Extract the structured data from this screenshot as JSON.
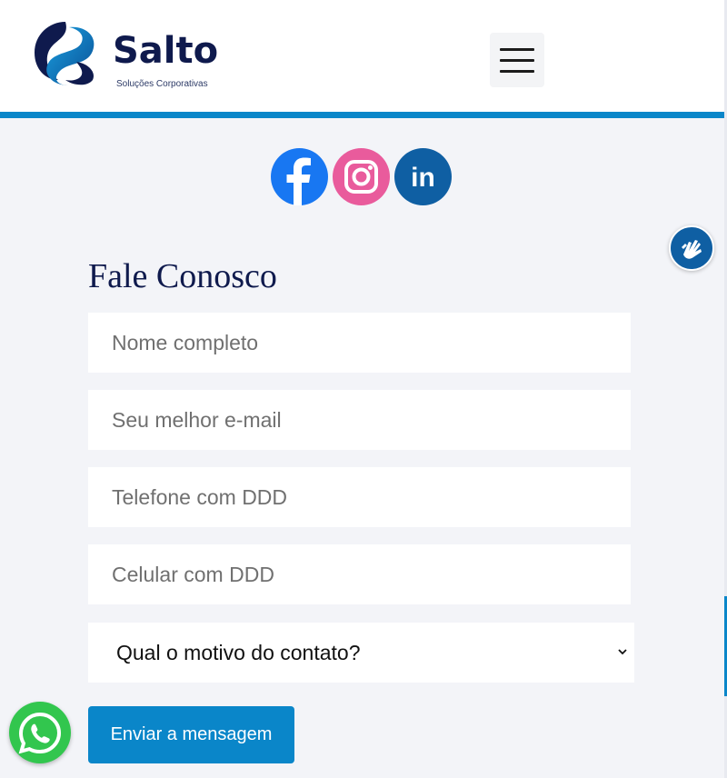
{
  "header": {
    "logo_text": "Salto",
    "logo_tagline": "Soluções Corporativas",
    "menu_icon": "hamburger-menu-icon"
  },
  "social": {
    "facebook_icon": "facebook-icon",
    "instagram_icon": "instagram-icon",
    "linkedin_icon": "linkedin-icon",
    "linkedin_text": "in"
  },
  "accessibility": {
    "icon": "sign-language-icon"
  },
  "form": {
    "title": "Fale Conosco",
    "name_placeholder": "Nome completo",
    "email_placeholder": "Seu melhor e-mail",
    "phone_placeholder": "Telefone com DDD",
    "mobile_placeholder": "Celular com DDD",
    "reason_selected": "Qual o motivo do contato?",
    "submit_label": "Enviar a mensagem"
  },
  "whatsapp": {
    "icon": "whatsapp-icon"
  },
  "colors": {
    "accent": "#0a86c9",
    "navy": "#0f1a4d",
    "background": "#f3f4f8",
    "whatsapp": "#32c64e",
    "facebook": "#1877f2",
    "instagram": "#e95b9c",
    "linkedin": "#0f5fa3"
  }
}
